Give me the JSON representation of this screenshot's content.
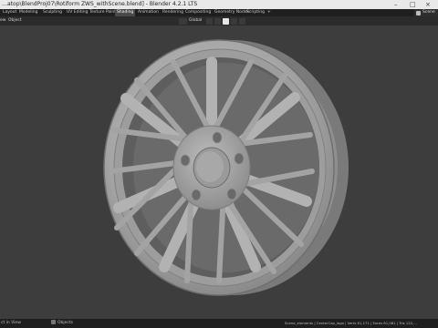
{
  "window": {
    "title": "…atop\\BlendProj07\\Rotiform ZWS_withScene.blend] - Blender 4.2.1 LTS",
    "controls": [
      "–",
      "□",
      "×"
    ]
  },
  "workspaces": [
    "Layout",
    "Modeling",
    "Sculpting",
    "UV Editing",
    "Texture Paint",
    "Shading",
    "Animation",
    "Rendering",
    "Compositing",
    "Geometry Nodes",
    "Scripting",
    "+"
  ],
  "active_workspace": "Shading",
  "scene_label": "Scene",
  "viewport_header": {
    "menus": [
      "ew",
      "Object"
    ],
    "transform_orientation": "Global"
  },
  "status": {
    "left": "ct in View",
    "middle": "Objects",
    "right": "Scene_elements | CenterCap_logo | Verts 61,171 | Faces 61,081 | Tris 122,..."
  },
  "colors": {
    "viewport_bg": "#3d3d3d",
    "wheel_base": "#a9a9a9",
    "active_tab": "#4a4a4a"
  }
}
